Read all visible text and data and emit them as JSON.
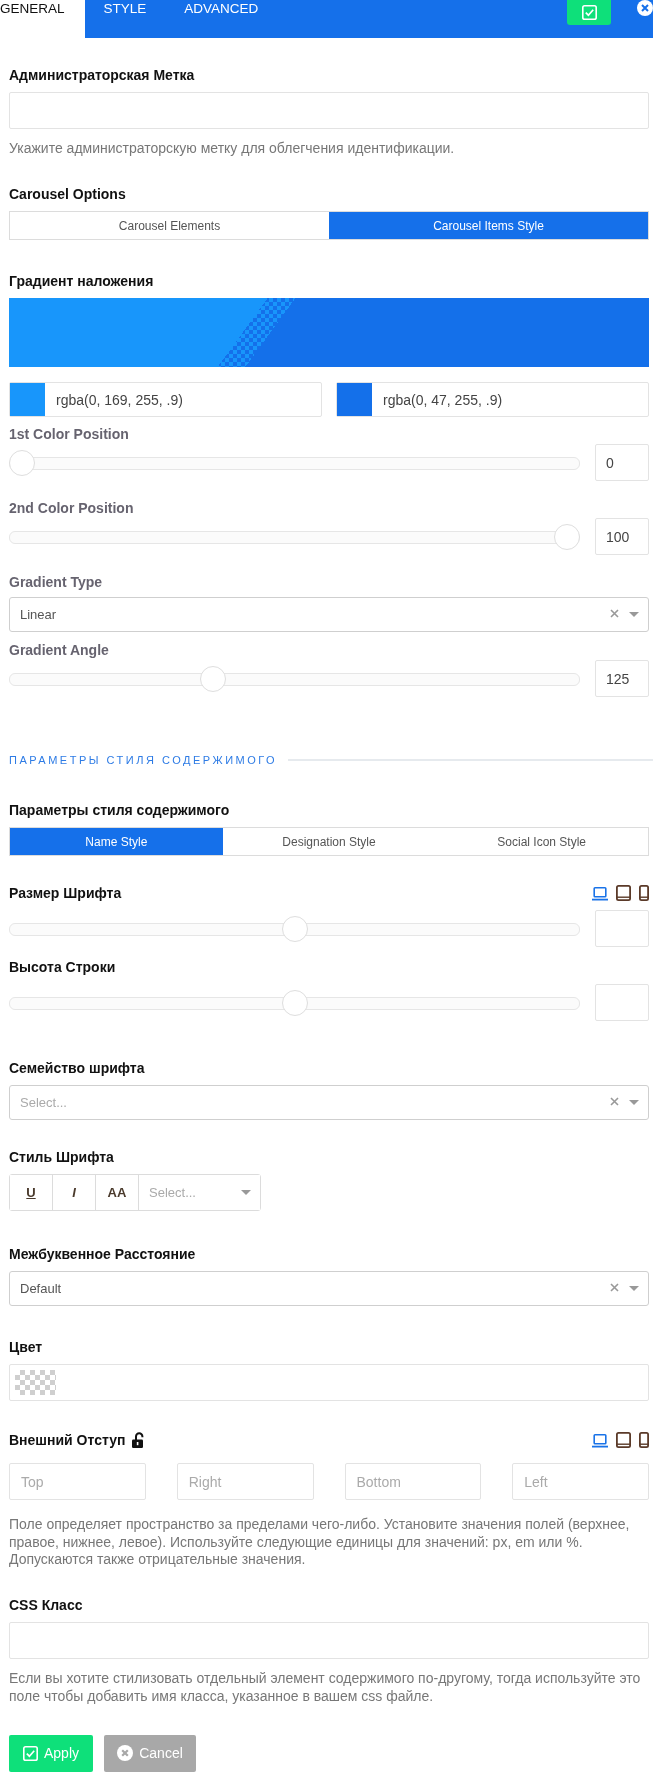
{
  "tabs": [
    {
      "label": "GENERAL",
      "selected": true
    },
    {
      "label": "STYLE",
      "selected": false
    },
    {
      "label": "ADVANCED",
      "selected": false
    }
  ],
  "fields": [
    {
      "kind": "text",
      "label": "Администраторская Метка",
      "help": "Укажите администраторскую метку для облегчения идентификации."
    },
    {
      "kind": "buttons",
      "label": "Carousel Options",
      "options": [
        {
          "label": "Carousel Elements",
          "selected": false
        },
        {
          "label": "Carousel Items Style",
          "selected": true
        }
      ]
    },
    {
      "kind": "gradient",
      "label": "Градиент наложения",
      "stops": [
        {
          "color": "#1896fb",
          "value": "rgba(0, 169, 255, .9)"
        },
        {
          "color": "#1470ea",
          "value": "rgba(0, 47, 255, .9)"
        }
      ],
      "controls": [
        {
          "kind": "slider",
          "label": "1st Color Position",
          "level": 0,
          "value": "0"
        },
        {
          "kind": "slider",
          "label": "2nd Color Position",
          "level": 1,
          "value": "100"
        },
        {
          "kind": "select",
          "label": "Gradient Type",
          "value": "Linear",
          "clearable": true
        },
        {
          "kind": "slider",
          "label": "Gradient Angle",
          "level": 0.35,
          "value": "125"
        }
      ]
    },
    {
      "kind": "section",
      "title": "ПАРАМЕТРЫ СТИЛЯ СОДЕРЖИМОГО"
    },
    {
      "kind": "buttons",
      "label": "Параметры стиля содержимого",
      "options": [
        {
          "label": "Name Style",
          "selected": true
        },
        {
          "label": "Designation Style",
          "selected": false
        },
        {
          "label": "Social Icon Style",
          "selected": false
        }
      ]
    },
    {
      "kind": "slider",
      "label": "Размер Шрифта",
      "level": 0.5,
      "devices": [
        {
          "kind": "laptop",
          "selected": true
        },
        {
          "kind": "tablet",
          "selected": false
        },
        {
          "kind": "phone",
          "selected": false
        }
      ]
    },
    {
      "kind": "slider",
      "label": "Высота Строки",
      "level": 0.5
    },
    {
      "kind": "select",
      "label": "Семейство шрифта",
      "placeholder": "Select...",
      "clearable": true
    },
    {
      "kind": "font_style",
      "label": "Стиль Шрифта",
      "buttons": [
        {
          "kind": "underline",
          "label": "U"
        },
        {
          "kind": "italic",
          "label": "I"
        },
        {
          "kind": "uppercase",
          "label": "AA"
        }
      ],
      "select": {
        "placeholder": "Select..."
      }
    },
    {
      "kind": "select",
      "label": "Межбуквенное Расстояние",
      "value": "Default",
      "clearable": true
    },
    {
      "kind": "color",
      "label": "Цвет"
    },
    {
      "kind": "margin",
      "label": "Внешний Отступ",
      "locked": false,
      "devices": [
        {
          "kind": "laptop",
          "selected": true
        },
        {
          "kind": "tablet",
          "selected": false
        },
        {
          "kind": "phone",
          "selected": false
        }
      ],
      "inputs": [
        {
          "placeholder": "Top"
        },
        {
          "placeholder": "Right"
        },
        {
          "placeholder": "Bottom"
        },
        {
          "placeholder": "Left"
        }
      ],
      "help": "Поле определяет пространство за пределами чего-либо. Установите значения полей (верхнее, правое, нижнее, левое). Используйте следующие единицы для значений: px, em или %. Допускаются также отрицательные значения."
    },
    {
      "kind": "text",
      "label": "CSS Класс",
      "help": "Если вы хотите стилизовать отдельный элемент содержимого по-другому, тогда используйте это поле чтобы добавить имя класса, указанное в вашем css файле."
    }
  ],
  "actions": [
    {
      "kind": "apply",
      "label": "Apply"
    },
    {
      "kind": "cancel",
      "label": "Cancel"
    }
  ]
}
